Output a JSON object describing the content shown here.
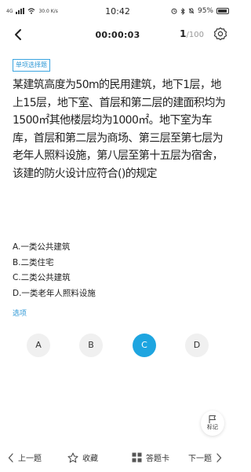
{
  "status_bar": {
    "network": "4G",
    "speed": "30.0 K/s",
    "time": "10:42",
    "battery": "95%"
  },
  "header": {
    "timer": "00:00:03",
    "current": "1",
    "total": "/100"
  },
  "question": {
    "tag": "单项选择题",
    "text": "某建筑高度为50m的民用建筑，地下1层，地上15层，地下室、首层和第二层的建面积均为1500㎡其他楼层均为1000㎡。地下室为车库，首层和第二层为商场、第三层至第七层为老年人照料设施，第八层至第十五层为宿舍，该建的防火设计应符合()的规定"
  },
  "options": [
    "A.一类公共建筑",
    "B.二类住宅",
    "C.二类公共建筑",
    "D.一类老年人照料设施"
  ],
  "options_label": "选项",
  "choices": [
    {
      "label": "A",
      "selected": false
    },
    {
      "label": "B",
      "selected": false
    },
    {
      "label": "C",
      "selected": true
    },
    {
      "label": "D",
      "selected": false
    }
  ],
  "mark_label": "标记",
  "bottom_bar": {
    "prev": "上一题",
    "favorite": "收藏",
    "answer_card": "答题卡",
    "next": "下一题"
  },
  "colors": {
    "accent": "#1ea5e0",
    "tag_border": "#3ba4e0"
  }
}
